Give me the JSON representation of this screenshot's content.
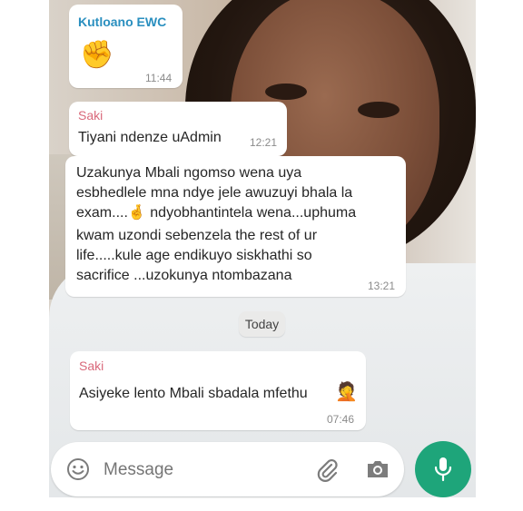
{
  "messages": [
    {
      "sender": "Kutloano EWC",
      "sender_color": "#2a8fbf",
      "emoji": "✊",
      "time": "11:44"
    },
    {
      "sender": "Saki",
      "sender_color": "#d9697b",
      "text": "Tiyani ndenze uAdmin",
      "time": "12:21"
    },
    {
      "lines": [
        "Uzakunya Mbali ngomso wena uya",
        "esbhedlele mna ndye jele awuzuyi bhala la",
        "exam....🤞 ndyobhantintela wena...uphuma",
        "kwam uzondi sebenzela the rest of ur",
        "life.....kule age endikuyo siskhathi so",
        "sacrifice ...uzokunya ntombazana"
      ],
      "time": "13:21"
    },
    {
      "sender": "Saki",
      "sender_color": "#d9697b",
      "text": "Asiyeke lento Mbali sbadala mfethu",
      "emoji": "🤦",
      "time": "07:46"
    }
  ],
  "date_chip": "Today",
  "composer": {
    "placeholder": "Message"
  },
  "icons": {
    "emoji": "emoji-icon",
    "attach": "paperclip-icon",
    "camera": "camera-icon",
    "mic": "mic-icon"
  },
  "colors": {
    "mic_button": "#1ea57a",
    "bubble": "#ffffff"
  }
}
